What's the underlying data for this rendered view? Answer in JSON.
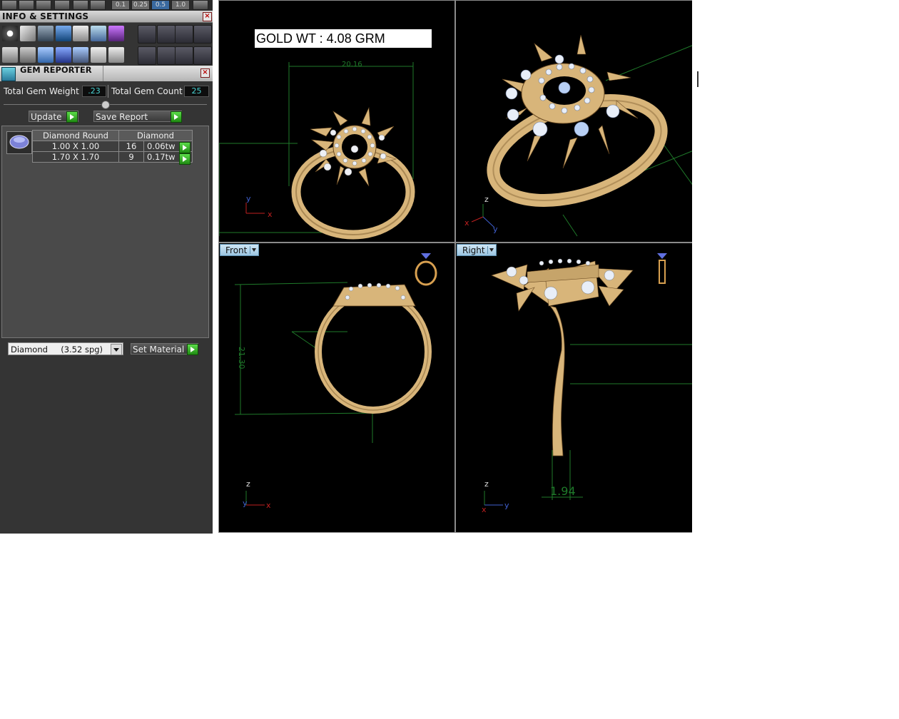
{
  "left_panel": {
    "top_values": [
      "0.1",
      "0.25",
      "0.5",
      "1.0"
    ],
    "info_header": "INFO & SETTINGS",
    "gem_reporter": {
      "title": "GEM REPORTER",
      "total_weight_label": "Total Gem Weight",
      "total_weight_value": ".23",
      "total_count_label": "Total Gem Count",
      "total_count_value": "25",
      "update_label": "Update",
      "save_report_label": "Save Report",
      "table": {
        "headers": [
          "Diamond Round",
          "Diamond"
        ],
        "rows": [
          {
            "size": "1.00 X 1.00",
            "count": "16",
            "weight": "0.06tw"
          },
          {
            "size": "1.70 X 1.70",
            "count": "9",
            "weight": "0.17tw"
          }
        ]
      },
      "material_select": "Diamond     (3.52 spg)",
      "set_material_label": "Set Material"
    }
  },
  "viewports": {
    "top": {
      "gold_weight": "GOLD WT : 4.08 GRM",
      "dim_label": "20.16"
    },
    "front": {
      "label": "Front",
      "dim_label": "21.30"
    },
    "right": {
      "label": "Right",
      "dim_label": "1.94"
    }
  },
  "axis": {
    "x": "x",
    "y": "y",
    "z": "z"
  },
  "colors": {
    "gold": "#d8b57a",
    "guide_green": "#1f7a2a",
    "axis_red": "#c02020",
    "axis_blue": "#4060d0",
    "panel_bg": "#343434"
  }
}
